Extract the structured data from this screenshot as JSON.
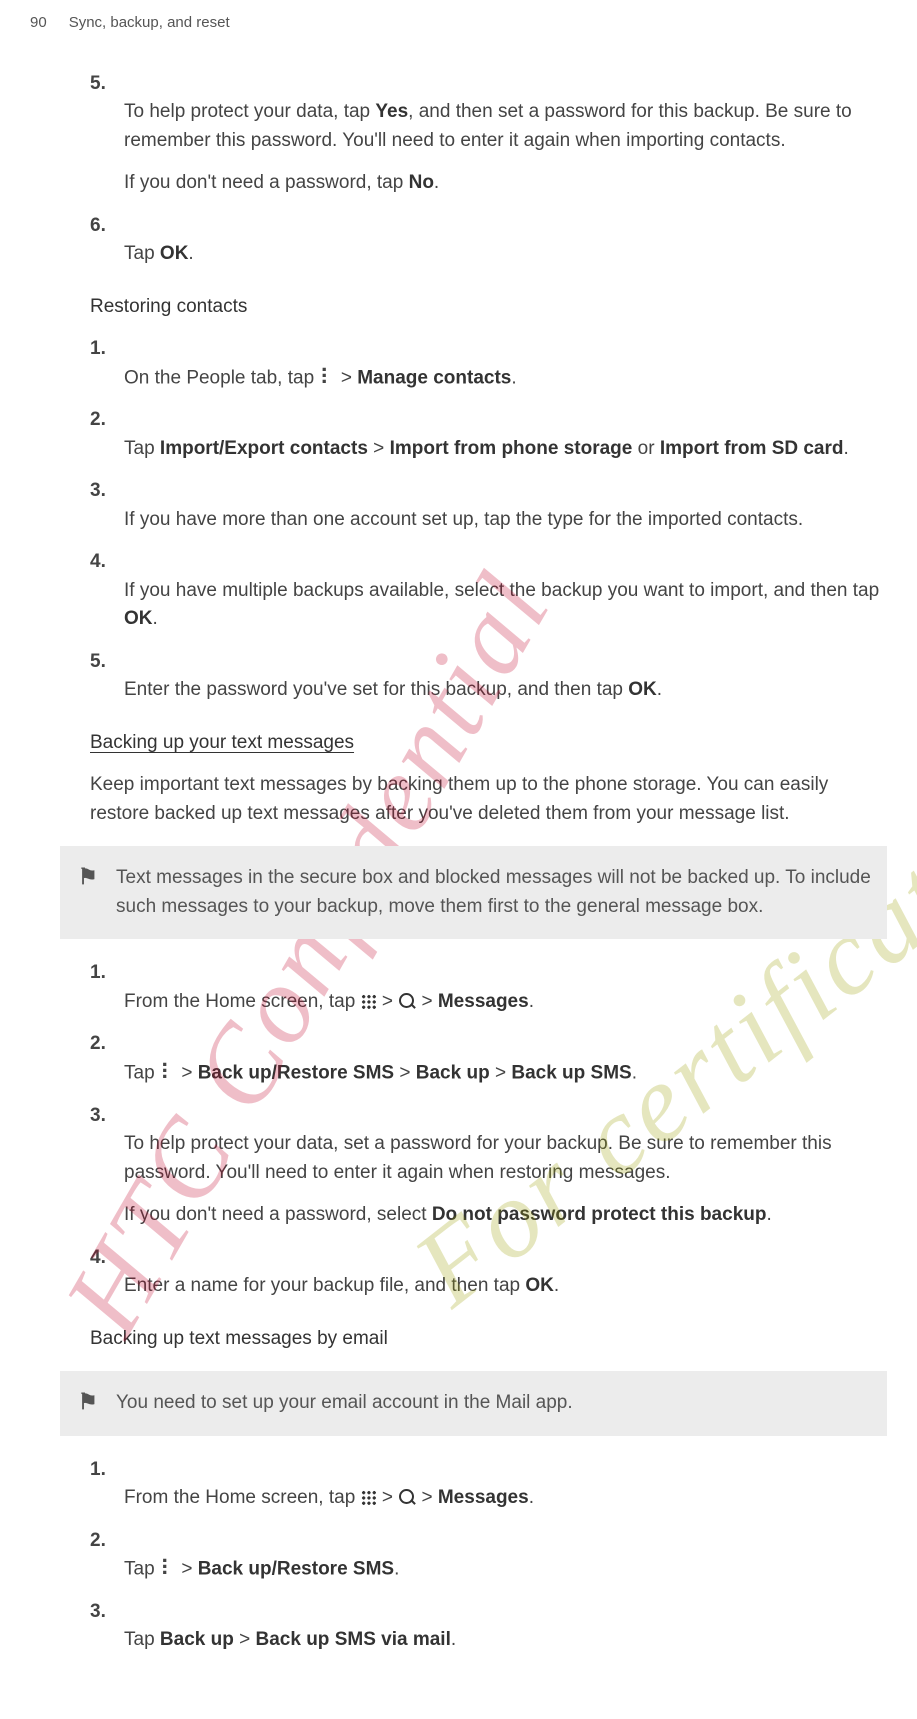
{
  "header": {
    "page_number": "90",
    "section_title": "Sync, backup, and reset"
  },
  "open_steps": {
    "s5": {
      "num": "5.",
      "p1a": "To help protect your data, tap ",
      "p1b": "Yes",
      "p1c": ", and then set a password for this backup. Be sure to remember this password. You'll need to enter it again when importing contacts.",
      "p2a": "If you don't need a password, tap ",
      "p2b": "No",
      "p2c": "."
    },
    "s6": {
      "num": "6.",
      "a": "Tap ",
      "b": "OK",
      "c": "."
    }
  },
  "restoring": {
    "heading": "Restoring contacts",
    "s1": {
      "num": "1.",
      "a": "On the People tab, tap ",
      "b": " > ",
      "c": "Manage contacts",
      "d": "."
    },
    "s2": {
      "num": "2.",
      "a": "Tap ",
      "b": "Import/Export contacts",
      "c": " > ",
      "d": "Import from phone storage",
      "e": " or ",
      "f": "Import from SD card",
      "g": "."
    },
    "s3": {
      "num": "3.",
      "t": "If you have more than one account set up, tap the type for the imported contacts."
    },
    "s4": {
      "num": "4.",
      "a": "If you have multiple backups available, select the backup you want to import, and then tap ",
      "b": "OK",
      "c": "."
    },
    "s5": {
      "num": "5.",
      "a": "Enter the password you've set for this backup, and then tap ",
      "b": "OK",
      "c": "."
    }
  },
  "backup_sms": {
    "heading": "Backing up your text messages",
    "intro": "Keep important text messages by backing them up to the phone storage. You can easily restore backed up text messages after you've deleted them from your message list.",
    "note": "Text messages in the secure box and blocked messages will not be backed up. To include such messages to your backup, move them first to the general message box.",
    "s1": {
      "num": "1.",
      "a": "From the Home screen, tap ",
      "b": " > ",
      "c": " > ",
      "d": "Messages",
      "e": "."
    },
    "s2": {
      "num": "2.",
      "a": "Tap ",
      "b": " > ",
      "c": "Back up/Restore SMS",
      "d": " > ",
      "e": "Back up",
      "f": " > ",
      "g": "Back up SMS",
      "h": "."
    },
    "s3": {
      "num": "3.",
      "p1": "To help protect your data, set a password for your backup. Be sure to remember this password. You'll need to enter it again when restoring messages.",
      "p2a": "If you don't need a password, select ",
      "p2b": "Do not password protect this backup",
      "p2c": "."
    },
    "s4": {
      "num": "4.",
      "a": "Enter a name for your backup file, and then tap ",
      "b": "OK",
      "c": "."
    }
  },
  "backup_email": {
    "heading": "Backing up text messages by email",
    "note": "You need to set up your email account in the Mail app.",
    "s1": {
      "num": "1.",
      "a": "From the Home screen, tap ",
      "b": " > ",
      "c": " > ",
      "d": "Messages",
      "e": "."
    },
    "s2": {
      "num": "2.",
      "a": "Tap ",
      "b": " > ",
      "c": "Back up/Restore SMS",
      "d": "."
    },
    "s3": {
      "num": "3.",
      "a": "Tap ",
      "b": "Back up",
      "c": " > ",
      "d": "Back up SMS via mail",
      "e": "."
    }
  },
  "watermarks": {
    "w1": "HTC Confidential",
    "w2": "For certification only"
  }
}
